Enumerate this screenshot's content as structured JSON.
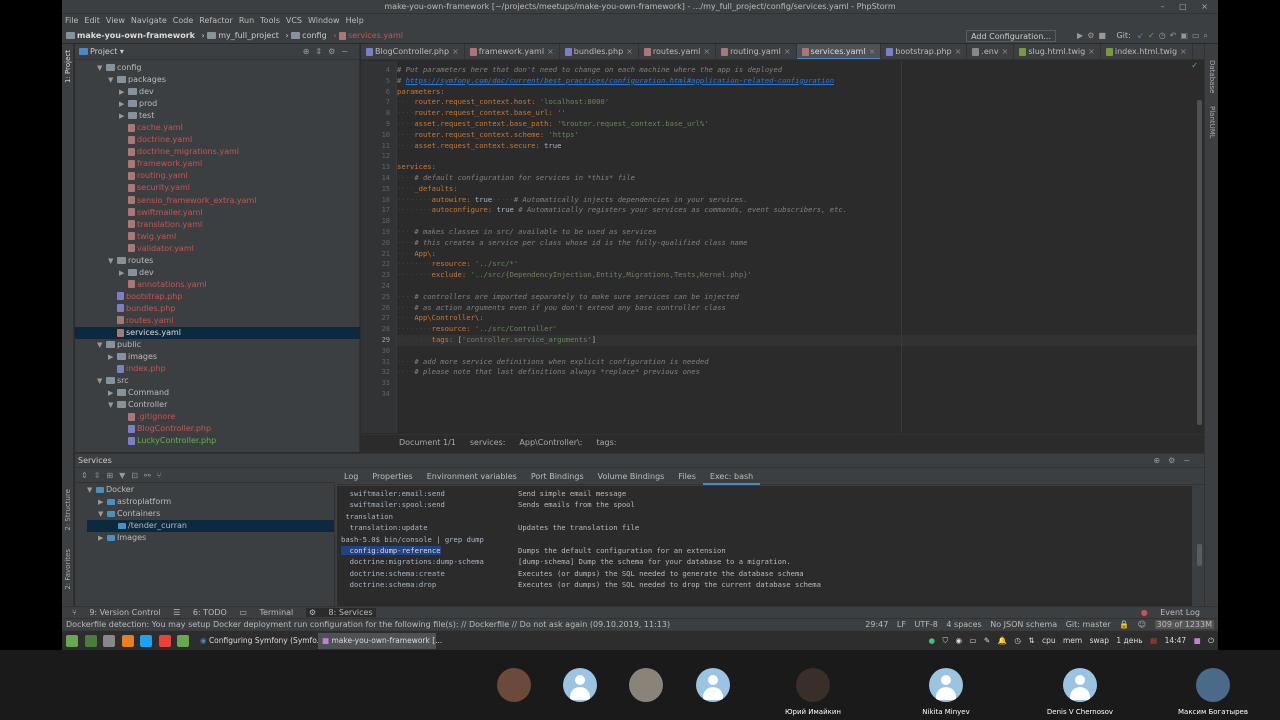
{
  "window": {
    "title": "make-you-own-framework [~/projects/meetups/make-you-own-framework] - .../my_full_project/config/services.yaml - PhpStorm",
    "controls": "– □ ×"
  },
  "menu": [
    "File",
    "Edit",
    "View",
    "Navigate",
    "Code",
    "Refactor",
    "Run",
    "Tools",
    "VCS",
    "Window",
    "Help"
  ],
  "breadcrumb": [
    "make-you-own-framework",
    "my_full_project",
    "config",
    "services.yaml"
  ],
  "toolbar": {
    "add_configuration": "Add Configuration...",
    "git_label": "Git:"
  },
  "project_panel": {
    "title": "Project",
    "tree": [
      {
        "indent": 2,
        "arrow": "▼",
        "type": "folder",
        "label": "config"
      },
      {
        "indent": 3,
        "arrow": "▼",
        "type": "folder",
        "label": "packages"
      },
      {
        "indent": 4,
        "arrow": "▶",
        "type": "folder",
        "label": "dev"
      },
      {
        "indent": 4,
        "arrow": "▶",
        "type": "folder",
        "label": "prod"
      },
      {
        "indent": 4,
        "arrow": "▶",
        "type": "folder",
        "label": "test"
      },
      {
        "indent": 4,
        "arrow": "",
        "type": "yaml",
        "label": "cache.yaml"
      },
      {
        "indent": 4,
        "arrow": "",
        "type": "yaml",
        "label": "doctrine.yaml"
      },
      {
        "indent": 4,
        "arrow": "",
        "type": "yaml",
        "label": "doctrine_migrations.yaml"
      },
      {
        "indent": 4,
        "arrow": "",
        "type": "yaml",
        "label": "framework.yaml"
      },
      {
        "indent": 4,
        "arrow": "",
        "type": "yaml",
        "label": "routing.yaml"
      },
      {
        "indent": 4,
        "arrow": "",
        "type": "yaml",
        "label": "security.yaml"
      },
      {
        "indent": 4,
        "arrow": "",
        "type": "yaml",
        "label": "sensio_framework_extra.yaml"
      },
      {
        "indent": 4,
        "arrow": "",
        "type": "yaml",
        "label": "swiftmailer.yaml"
      },
      {
        "indent": 4,
        "arrow": "",
        "type": "yaml",
        "label": "translation.yaml"
      },
      {
        "indent": 4,
        "arrow": "",
        "type": "yaml",
        "label": "twig.yaml"
      },
      {
        "indent": 4,
        "arrow": "",
        "type": "yaml",
        "label": "validator.yaml"
      },
      {
        "indent": 3,
        "arrow": "▼",
        "type": "folder",
        "label": "routes"
      },
      {
        "indent": 4,
        "arrow": "▶",
        "type": "folder",
        "label": "dev"
      },
      {
        "indent": 4,
        "arrow": "",
        "type": "yaml",
        "label": "annotations.yaml"
      },
      {
        "indent": 3,
        "arrow": "",
        "type": "phpr",
        "label": "bootstrap.php"
      },
      {
        "indent": 3,
        "arrow": "",
        "type": "phpr",
        "label": "bundles.php"
      },
      {
        "indent": 3,
        "arrow": "",
        "type": "yaml",
        "label": "routes.yaml"
      },
      {
        "indent": 3,
        "arrow": "",
        "type": "white",
        "label": "services.yaml",
        "selected": true
      },
      {
        "indent": 2,
        "arrow": "▼",
        "type": "folder",
        "label": "public"
      },
      {
        "indent": 3,
        "arrow": "▶",
        "type": "folder",
        "label": "images"
      },
      {
        "indent": 3,
        "arrow": "",
        "type": "phpr",
        "label": "index.php"
      },
      {
        "indent": 2,
        "arrow": "▼",
        "type": "folder",
        "label": "src"
      },
      {
        "indent": 3,
        "arrow": "▶",
        "type": "folder",
        "label": "Command"
      },
      {
        "indent": 3,
        "arrow": "▼",
        "type": "folder",
        "label": "Controller"
      },
      {
        "indent": 4,
        "arrow": "",
        "type": "yaml",
        "label": ".gitignore"
      },
      {
        "indent": 4,
        "arrow": "",
        "type": "phpr",
        "label": "BlogController.php"
      },
      {
        "indent": 4,
        "arrow": "",
        "type": "green",
        "label": "LuckyController.php"
      }
    ]
  },
  "editor": {
    "tabs": [
      {
        "label": "BlogController.php",
        "icon": "php"
      },
      {
        "label": "framework.yaml",
        "icon": "yaml"
      },
      {
        "label": "bundles.php",
        "icon": "php"
      },
      {
        "label": "routes.yaml",
        "icon": "yaml"
      },
      {
        "label": "routing.yaml",
        "icon": "yaml"
      },
      {
        "label": "services.yaml",
        "icon": "yaml",
        "active": true
      },
      {
        "label": "bootstrap.php",
        "icon": "php"
      },
      {
        "label": ".env",
        "icon": "env"
      },
      {
        "label": "slug.html.twig",
        "icon": "twig"
      },
      {
        "label": "index.html.twig",
        "icon": "twig"
      }
    ],
    "lines": [
      {
        "n": "4",
        "parts": [
          [
            "c-cmt",
            "# Put parameters here that don't need to change on each machine where the app is deployed"
          ]
        ]
      },
      {
        "n": "5",
        "parts": [
          [
            "c-cmt",
            "# "
          ],
          [
            "c-link",
            "https://symfony.com/doc/current/best_practices/configuration.html#application-related-configuration"
          ]
        ]
      },
      {
        "n": "6",
        "parts": [
          [
            "c-key",
            "parameters:"
          ]
        ]
      },
      {
        "n": "7",
        "parts": [
          [
            "c-dots",
            "····"
          ],
          [
            "c-key",
            "router.request_context.host: "
          ],
          [
            "c-str",
            "'localhost:8000'"
          ]
        ]
      },
      {
        "n": "8",
        "parts": [
          [
            "c-dots",
            "····"
          ],
          [
            "c-key",
            "router.request_context.base_url: "
          ],
          [
            "c-str",
            "''"
          ]
        ]
      },
      {
        "n": "9",
        "parts": [
          [
            "c-dots",
            "····"
          ],
          [
            "c-key",
            "asset.request_context.base_path: "
          ],
          [
            "c-str",
            "'%router.request_context.base_url%'"
          ]
        ]
      },
      {
        "n": "10",
        "parts": [
          [
            "c-dots",
            "····"
          ],
          [
            "c-key",
            "router.request_context.scheme: "
          ],
          [
            "c-str",
            "'https'"
          ]
        ]
      },
      {
        "n": "11",
        "parts": [
          [
            "c-dots",
            "····"
          ],
          [
            "c-key",
            "asset.request_context.secure: "
          ],
          [
            "c-plain",
            "true"
          ]
        ]
      },
      {
        "n": "12",
        "parts": []
      },
      {
        "n": "13",
        "parts": [
          [
            "c-key",
            "services:"
          ]
        ]
      },
      {
        "n": "14",
        "parts": [
          [
            "c-dots",
            "····"
          ],
          [
            "c-cmt",
            "# default configuration for services in *this* file"
          ]
        ]
      },
      {
        "n": "15",
        "parts": [
          [
            "c-dots",
            "····"
          ],
          [
            "c-key",
            "_defaults:"
          ]
        ]
      },
      {
        "n": "16",
        "parts": [
          [
            "c-dots",
            "········"
          ],
          [
            "c-key",
            "autowire: "
          ],
          [
            "c-plain",
            "true"
          ],
          [
            "c-dots",
            "·····"
          ],
          [
            "c-cmt",
            "# Automatically injects dependencies in your services."
          ]
        ]
      },
      {
        "n": "17",
        "parts": [
          [
            "c-dots",
            "········"
          ],
          [
            "c-key",
            "autoconfigure: "
          ],
          [
            "c-plain",
            "true "
          ],
          [
            "c-cmt",
            "# Automatically registers your services as commands, event subscribers, etc."
          ]
        ]
      },
      {
        "n": "18",
        "parts": []
      },
      {
        "n": "19",
        "parts": [
          [
            "c-dots",
            "····"
          ],
          [
            "c-cmt",
            "# makes classes in src/ available to be used as services"
          ]
        ]
      },
      {
        "n": "20",
        "parts": [
          [
            "c-dots",
            "····"
          ],
          [
            "c-cmt",
            "# this creates a service per class whose id is the fully-qualified class name"
          ]
        ]
      },
      {
        "n": "21",
        "parts": [
          [
            "c-dots",
            "····"
          ],
          [
            "c-key",
            "App\\:"
          ]
        ]
      },
      {
        "n": "22",
        "parts": [
          [
            "c-dots",
            "········"
          ],
          [
            "c-key",
            "resource: "
          ],
          [
            "c-str",
            "'../src/*'"
          ]
        ]
      },
      {
        "n": "23",
        "parts": [
          [
            "c-dots",
            "········"
          ],
          [
            "c-key",
            "exclude: "
          ],
          [
            "c-str",
            "'../src/{DependencyInjection,Entity,Migrations,Tests,Kernel.php}'"
          ]
        ]
      },
      {
        "n": "24",
        "parts": []
      },
      {
        "n": "25",
        "parts": [
          [
            "c-dots",
            "····"
          ],
          [
            "c-cmt",
            "# controllers are imported separately to make sure services can be injected"
          ]
        ]
      },
      {
        "n": "26",
        "parts": [
          [
            "c-dots",
            "····"
          ],
          [
            "c-cmt",
            "# as action arguments even if you don't extend any base controller class"
          ]
        ]
      },
      {
        "n": "27",
        "parts": [
          [
            "c-dots",
            "····"
          ],
          [
            "c-key",
            "App\\Controller\\:"
          ]
        ]
      },
      {
        "n": "28",
        "parts": [
          [
            "c-dots",
            "········"
          ],
          [
            "c-key",
            "resource: "
          ],
          [
            "c-str",
            "'../src/Controller'"
          ]
        ]
      },
      {
        "n": "29",
        "parts": [
          [
            "c-dots",
            "········"
          ],
          [
            "c-key",
            "tags: "
          ],
          [
            "c-plain",
            "["
          ],
          [
            "c-str",
            "'controller.service_arguments'"
          ],
          [
            "c-plain",
            "]"
          ]
        ],
        "current": true
      },
      {
        "n": "30",
        "parts": []
      },
      {
        "n": "31",
        "parts": [
          [
            "c-dots",
            "····"
          ],
          [
            "c-cmt",
            "# add more service definitions when explicit configuration is needed"
          ]
        ]
      },
      {
        "n": "32",
        "parts": [
          [
            "c-dots",
            "····"
          ],
          [
            "c-cmt",
            "# please note that last definitions always *replace* previous ones"
          ]
        ]
      },
      {
        "n": "33",
        "parts": []
      },
      {
        "n": "34",
        "parts": []
      }
    ],
    "breadcrumb": [
      "Document 1/1",
      "services:",
      "App\\Controller\\:",
      "tags:"
    ]
  },
  "services_panel": {
    "title": "Services",
    "tree": [
      {
        "indent": 0,
        "arrow": "▼",
        "icon": "docker",
        "label": "Docker"
      },
      {
        "indent": 1,
        "arrow": "▶",
        "icon": "docker",
        "label": "astroplatform"
      },
      {
        "indent": 1,
        "arrow": "▼",
        "icon": "docker",
        "label": "Containers"
      },
      {
        "indent": 2,
        "arrow": "",
        "icon": "docker",
        "label": "/tender_curran",
        "selected": true
      },
      {
        "indent": 1,
        "arrow": "▶",
        "icon": "docker",
        "label": "Images"
      }
    ],
    "tabs": [
      {
        "label": "Log"
      },
      {
        "label": "Properties"
      },
      {
        "label": "Environment variables"
      },
      {
        "label": "Port Bindings"
      },
      {
        "label": "Volume Bindings"
      },
      {
        "label": "Files"
      },
      {
        "label": "Exec: bash",
        "active": true
      }
    ],
    "terminal": [
      {
        "cmd": "  swiftmailer:email:send",
        "desc": "Send simple email message"
      },
      {
        "cmd": "  swiftmailer:spool:send",
        "desc": "Sends emails from the spool"
      },
      {
        "cmd": " translation",
        "desc": ""
      },
      {
        "cmd": "  translation:update",
        "desc": "Updates the translation file"
      },
      {
        "cmd": "bash-5.0$ bin/console | grep dump",
        "desc": ""
      },
      {
        "cmd": "  config:dump-reference",
        "desc": "Dumps the default configuration for an extension",
        "highlight": true
      },
      {
        "cmd": "  doctrine:migrations:dump-schema",
        "desc": "[dump-schema] Dump the schema for your database to a migration."
      },
      {
        "cmd": "  doctrine:schema:create",
        "desc": "Executes (or dumps) the SQL needed to generate the database schema"
      },
      {
        "cmd": "  doctrine:schema:drop",
        "desc": "Executes (or dumps) the SQL needed to drop the current database schema"
      }
    ]
  },
  "side_labels": {
    "project": "1: Project",
    "structure": "2: Structure",
    "favorites": "2: Favorites",
    "database": "Database",
    "plantuml": "PlantUML"
  },
  "bottom_tabs": [
    "9: Version Control",
    "6: TODO",
    "Terminal",
    "8: Services"
  ],
  "event_log": "Event Log",
  "status": {
    "message": "Dockerfile detection: You may setup Docker deployment run configuration for the following file(s): // Dockerfile // Do not ask again (09.10.2019, 11:13)",
    "position": "29:47",
    "line_sep": "LF",
    "encoding": "UTF-8",
    "indent": "4 spaces",
    "schema": "No JSON schema",
    "git": "Git: master",
    "memory": "309 of 1233M"
  },
  "taskbar": {
    "tasks": [
      "Configuring Symfony (Symfo...",
      "make-you-own-framework [..."
    ],
    "tray": [
      "cpu",
      "mem",
      "swap",
      "1 день",
      "14:47"
    ]
  },
  "participants": [
    {
      "name": "",
      "kind": "photo"
    },
    {
      "name": "",
      "kind": "default"
    },
    {
      "name": "",
      "kind": "photo"
    },
    {
      "name": "",
      "kind": "default"
    },
    {
      "name": "Юрий Имайкин",
      "kind": "photo"
    },
    {
      "name": "Nikita Minyev",
      "kind": "default"
    },
    {
      "name": "Denis V Chernosov",
      "kind": "default"
    },
    {
      "name": "Максим Богатырев",
      "kind": "photo"
    }
  ]
}
